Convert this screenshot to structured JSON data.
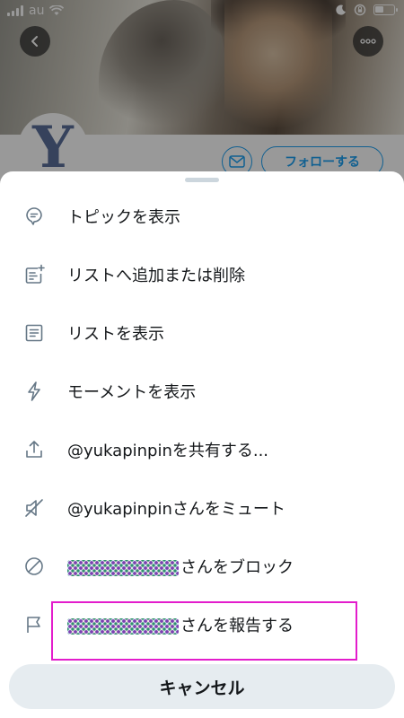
{
  "status_bar": {
    "carrier": "au",
    "battery_level": 0.45
  },
  "profile": {
    "avatar_letter": "Y",
    "follow_label": "フォローする"
  },
  "sheet": {
    "items": [
      {
        "icon": "topic-icon",
        "label": "トピックを表示"
      },
      {
        "icon": "list-add-icon",
        "label": "リストへ追加または削除"
      },
      {
        "icon": "list-icon",
        "label": "リストを表示"
      },
      {
        "icon": "lightning-icon",
        "label": "モーメントを表示"
      },
      {
        "icon": "share-icon",
        "label": "@yukapinpinを共有する..."
      },
      {
        "icon": "mute-icon",
        "label": "@yukapinpinさんをミュート"
      },
      {
        "icon": "block-icon",
        "label": "さんをブロック"
      },
      {
        "icon": "flag-icon",
        "label": "さんを報告する"
      }
    ],
    "cancel_label": "キャンセル"
  },
  "colors": {
    "accent": "#1da1f2",
    "highlight": "#e31ccc",
    "icon": "#657786",
    "cancel_bg": "#e6ecf0"
  }
}
